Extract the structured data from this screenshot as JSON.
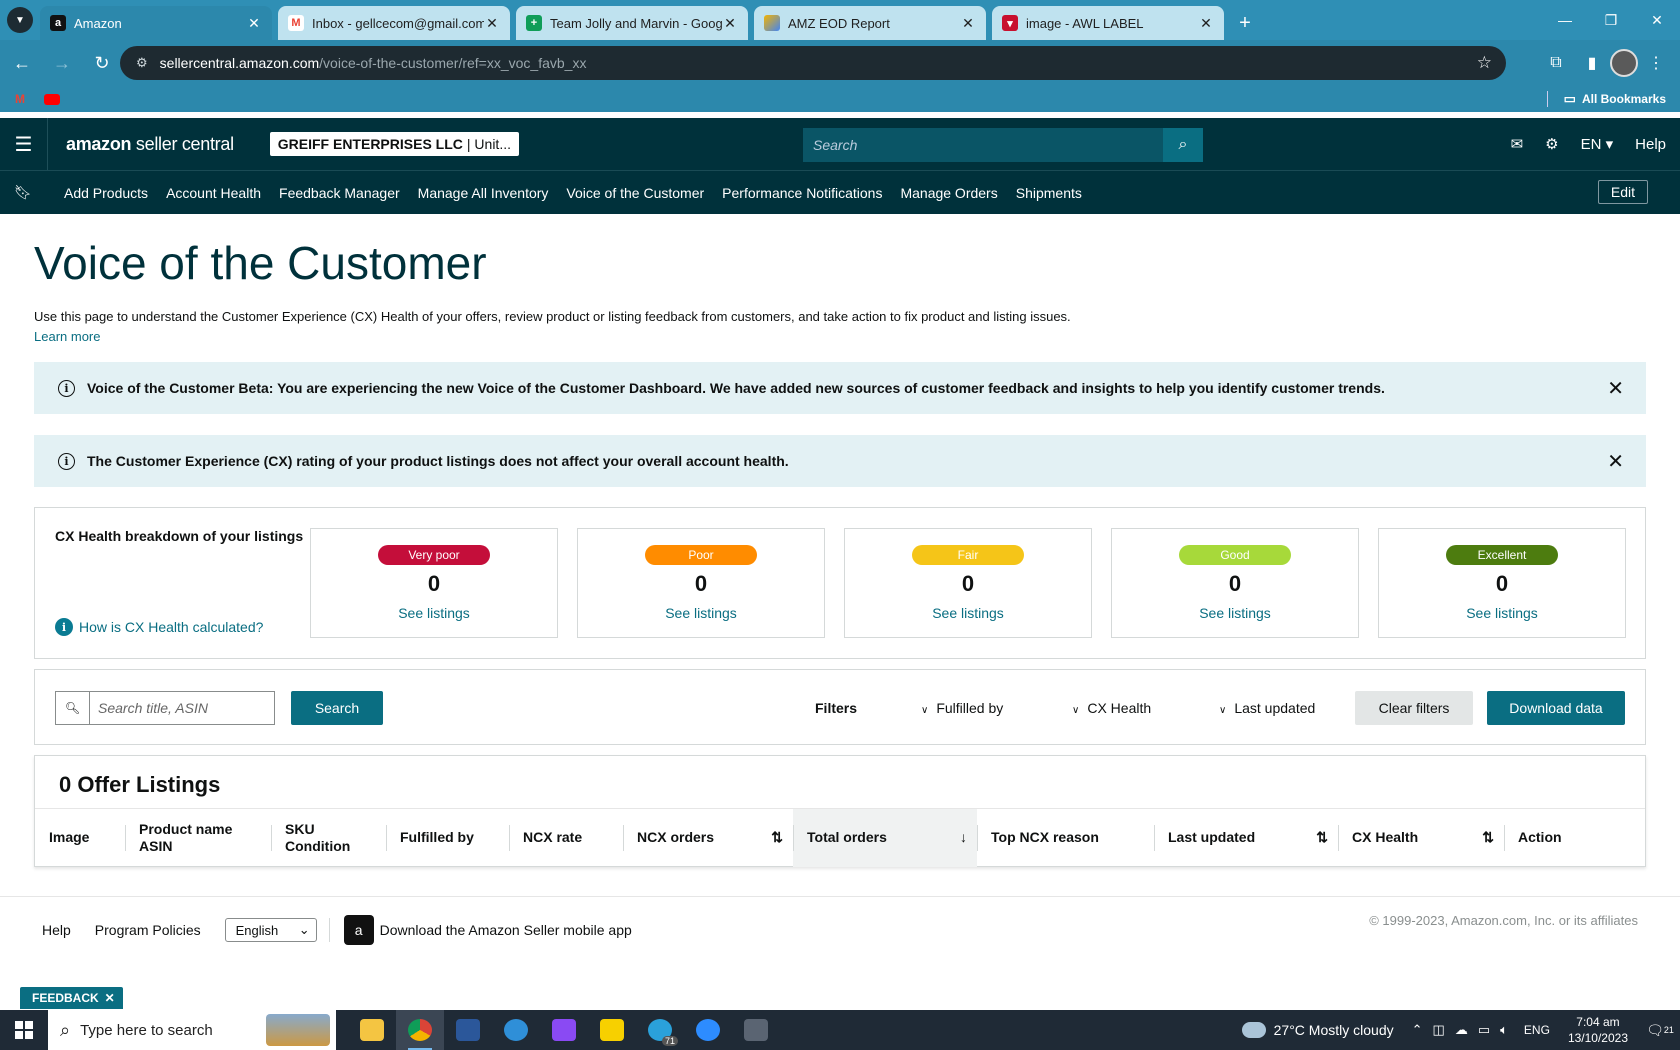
{
  "browser": {
    "tabs": [
      {
        "title": "Amazon",
        "icon": "amazon-icon",
        "active": true
      },
      {
        "title": "Inbox - gellcecom@gmail.com",
        "icon": "gmail-icon",
        "active": false
      },
      {
        "title": "Team Jolly and Marvin - Googl",
        "icon": "sheets-icon",
        "active": false
      },
      {
        "title": "AMZ EOD Report",
        "icon": "report-icon",
        "active": false
      },
      {
        "title": "image - AWL LABEL",
        "icon": "awl-icon",
        "active": false
      }
    ],
    "url_host": "sellercentral.amazon.com",
    "url_path": "/voice-of-the-customer/ref=xx_voc_favb_xx",
    "all_bookmarks": "All Bookmarks"
  },
  "header": {
    "logo_bold": "amazon",
    "logo_rest": "seller central",
    "account_name": "GREIFF ENTERPRISES LLC",
    "account_region": "| Unit...",
    "search_placeholder": "Search",
    "language": "EN",
    "help": "Help"
  },
  "nav": {
    "items": [
      "Add Products",
      "Account Health",
      "Feedback Manager",
      "Manage All Inventory",
      "Voice of the Customer",
      "Performance Notifications",
      "Manage Orders",
      "Shipments"
    ],
    "edit": "Edit"
  },
  "page": {
    "title": "Voice of the Customer",
    "description": "Use this page to understand the Customer Experience (CX) Health of your offers, review product or listing feedback from customers, and take action to fix product and listing issues.",
    "learn_more": "Learn more",
    "alerts": [
      "Voice of the Customer Beta: You are experiencing the new Voice of the Customer Dashboard. We have added new sources of customer feedback and insights to help you identify customer trends.",
      "The Customer Experience (CX) rating of your product listings does not affect your overall account health."
    ]
  },
  "cx_health": {
    "title": "CX Health breakdown of your listings",
    "how_link": "How is CX Health calculated?",
    "cards": [
      {
        "label": "Very poor",
        "count": "0",
        "link": "See listings",
        "color": "#c40e3a"
      },
      {
        "label": "Poor",
        "count": "0",
        "link": "See listings",
        "color": "#ff8c00"
      },
      {
        "label": "Fair",
        "count": "0",
        "link": "See listings",
        "color": "#f5c518"
      },
      {
        "label": "Good",
        "count": "0",
        "link": "See listings",
        "color": "#a7d93a"
      },
      {
        "label": "Excellent",
        "count": "0",
        "link": "See listings",
        "color": "#4d7c0f"
      }
    ]
  },
  "search": {
    "placeholder": "Search title, ASIN",
    "button": "Search",
    "filters_label": "Filters",
    "filters": [
      "Fulfilled by",
      "CX Health",
      "Last updated"
    ],
    "clear": "Clear filters",
    "download": "Download data"
  },
  "table": {
    "title": "0 Offer Listings",
    "columns": [
      {
        "line1": "Image",
        "line2": ""
      },
      {
        "line1": "Product name",
        "line2": "ASIN"
      },
      {
        "line1": "SKU",
        "line2": "Condition"
      },
      {
        "line1": "Fulfilled by",
        "line2": ""
      },
      {
        "line1": "NCX rate",
        "line2": ""
      },
      {
        "line1": "NCX orders",
        "line2": ""
      },
      {
        "line1": "Total orders",
        "line2": ""
      },
      {
        "line1": "Top NCX reason",
        "line2": ""
      },
      {
        "line1": "Last updated",
        "line2": ""
      },
      {
        "line1": "CX Health",
        "line2": ""
      },
      {
        "line1": "Action",
        "line2": ""
      }
    ]
  },
  "footer": {
    "help": "Help",
    "policies": "Program Policies",
    "language": "English",
    "app": "Download the Amazon Seller mobile app",
    "copyright": "© 1999-2023, Amazon.com, Inc. or its affiliates",
    "feedback": "FEEDBACK"
  },
  "taskbar": {
    "search_placeholder": "Type here to search",
    "weather": "27°C  Mostly cloudy",
    "lang": "ENG",
    "time": "7:04 am",
    "date": "13/10/2023",
    "telegram_badge": "71",
    "notifications": "21"
  }
}
